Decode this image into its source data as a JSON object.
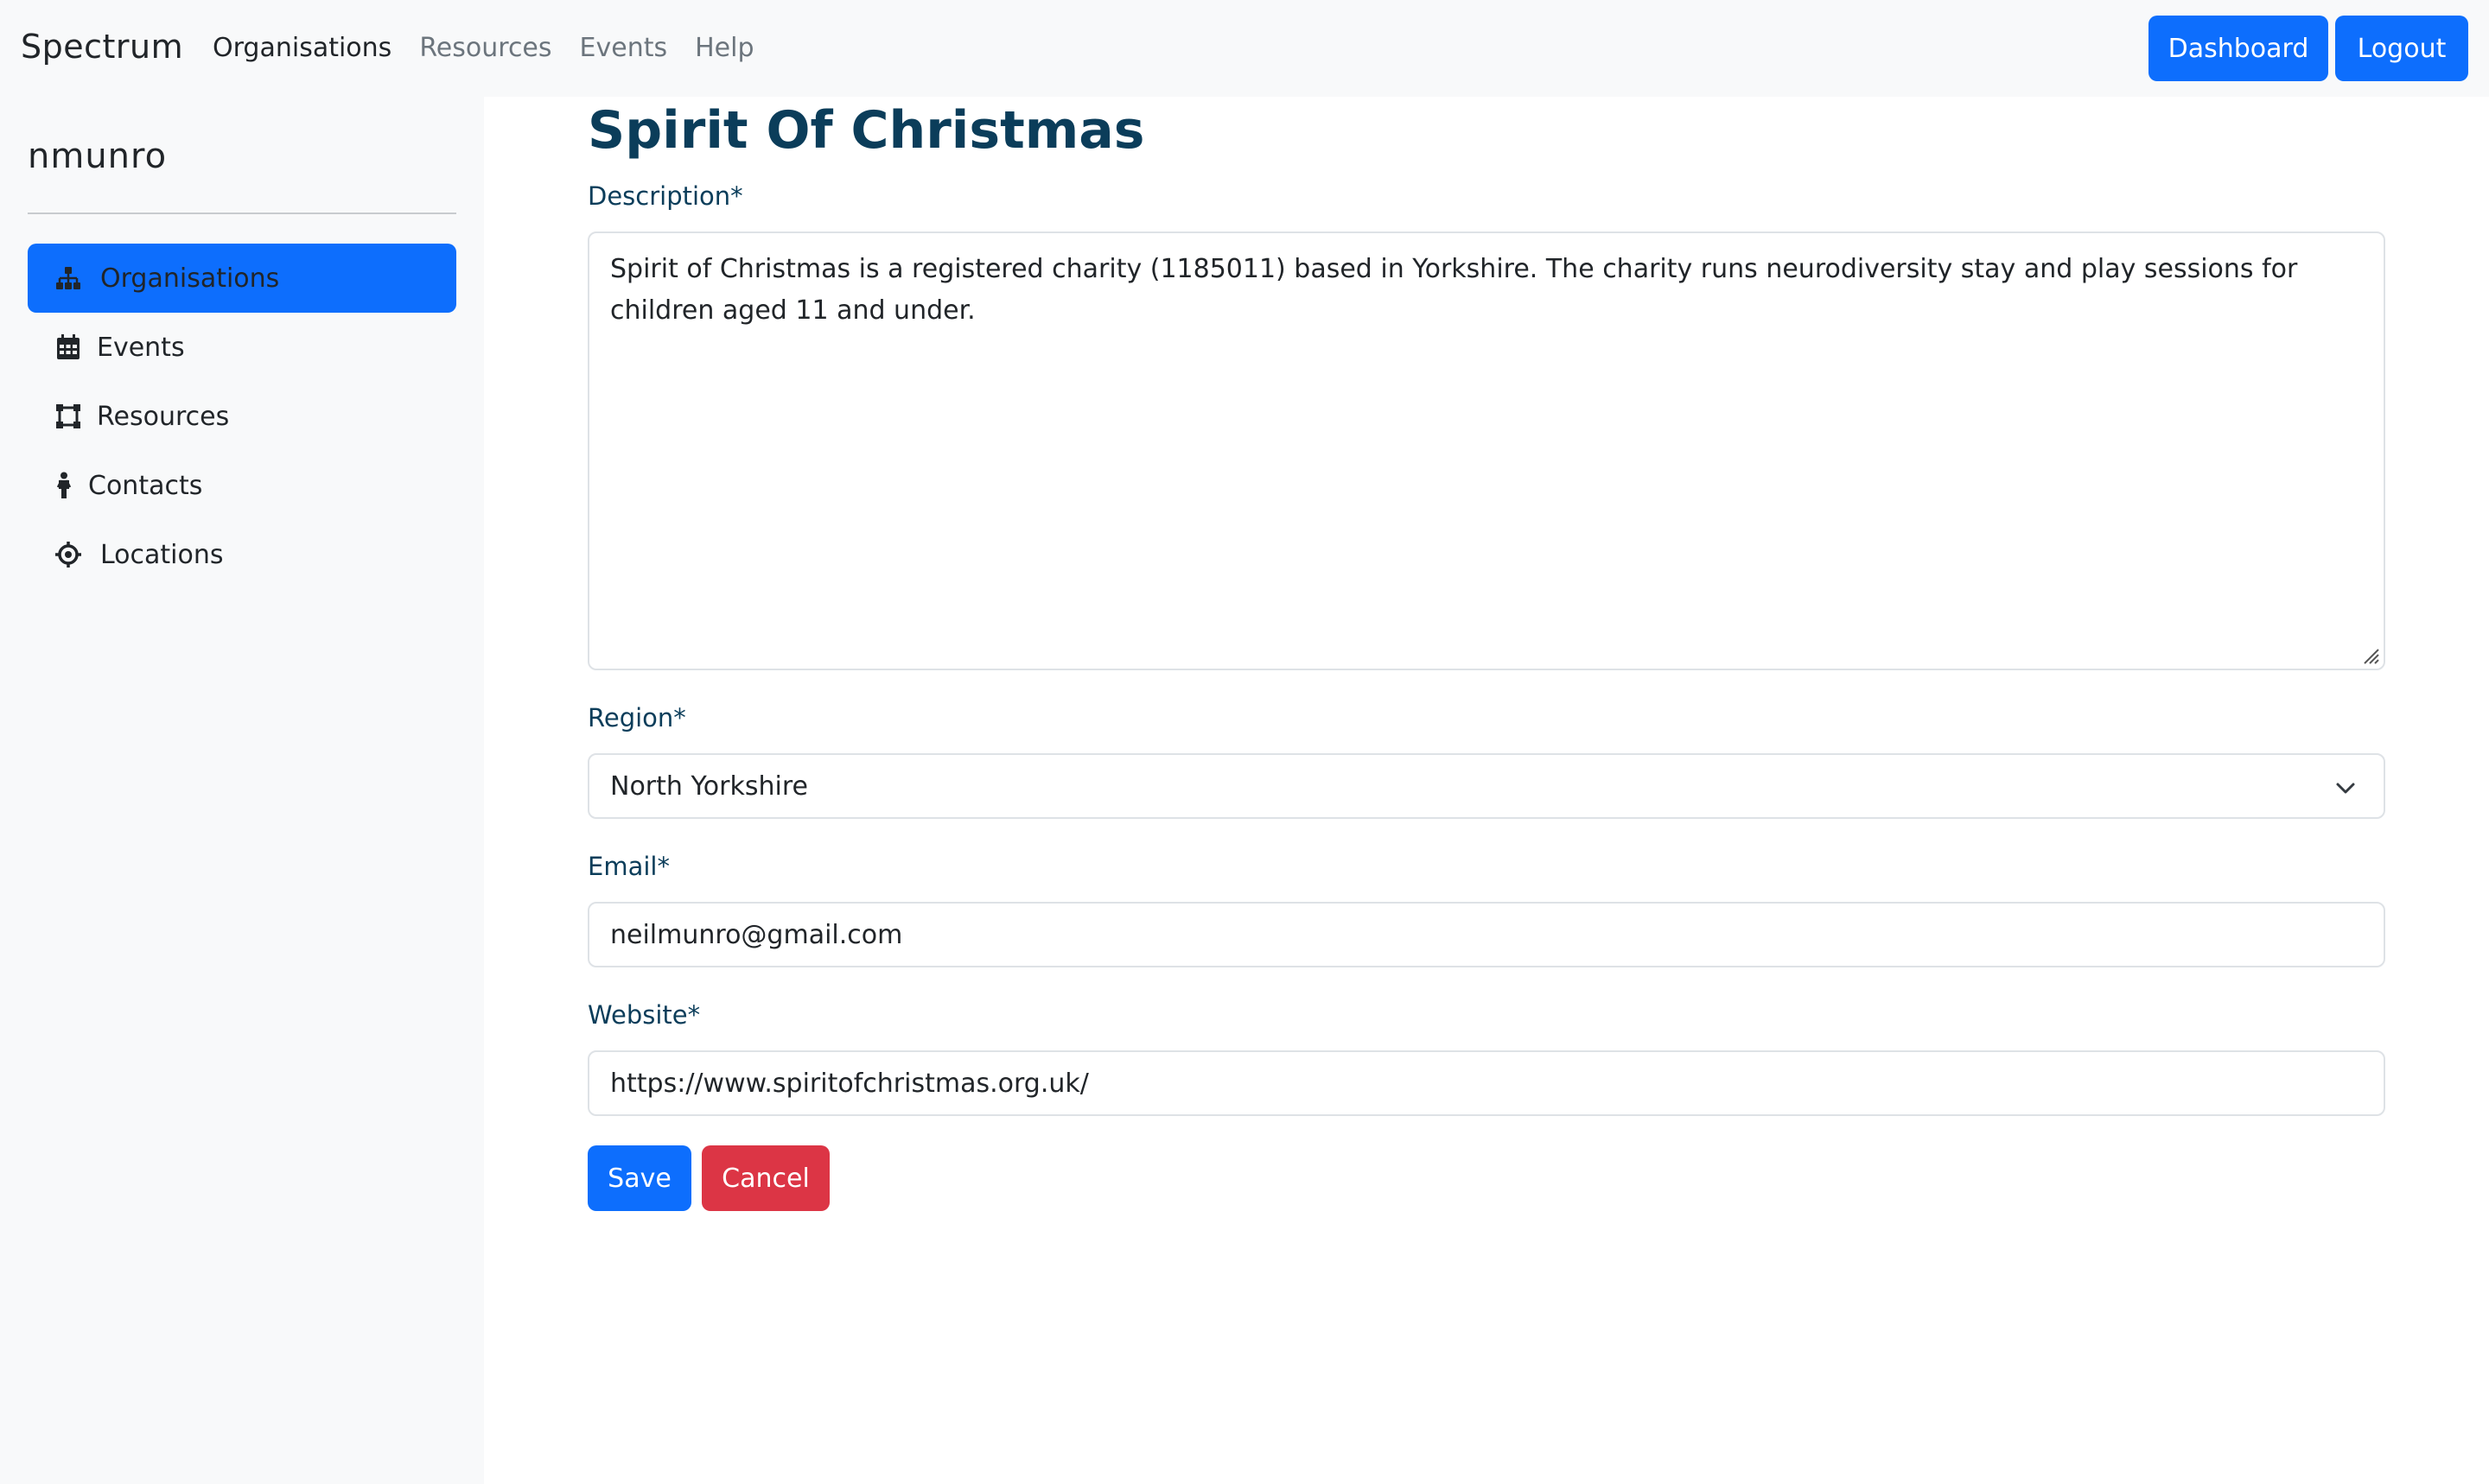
{
  "app": {
    "brand": "Spectrum"
  },
  "topnav": {
    "items": [
      "Organisations",
      "Resources",
      "Events",
      "Help"
    ],
    "active": "Organisations",
    "dashboard_label": "Dashboard",
    "logout_label": "Logout"
  },
  "sidebar": {
    "username": "nmunro",
    "items": [
      {
        "label": "Organisations",
        "icon": "sitemap-icon",
        "active": true
      },
      {
        "label": "Events",
        "icon": "calendar-icon",
        "active": false
      },
      {
        "label": "Resources",
        "icon": "vector-square-icon",
        "active": false
      },
      {
        "label": "Contacts",
        "icon": "person-icon",
        "active": false
      },
      {
        "label": "Locations",
        "icon": "crosshairs-icon",
        "active": false
      }
    ]
  },
  "form": {
    "title": "Spirit Of Christmas",
    "description_label": "Description*",
    "description_value": "Spirit of Christmas is a registered charity (1185011) based in Yorkshire. The charity runs neurodiversity stay and play sessions for children aged 11 and under.",
    "region_label": "Region*",
    "region_value": "North Yorkshire",
    "email_label": "Email*",
    "email_value": "neilmunro@gmail.com",
    "website_label": "Website*",
    "website_value": "https://www.spiritofchristmas.org.uk/",
    "save_label": "Save",
    "cancel_label": "Cancel"
  },
  "colors": {
    "primary": "#0d6efd",
    "danger": "#dc3545",
    "heading": "#0b3d5a",
    "sidebar_bg": "#f8f9fa"
  }
}
